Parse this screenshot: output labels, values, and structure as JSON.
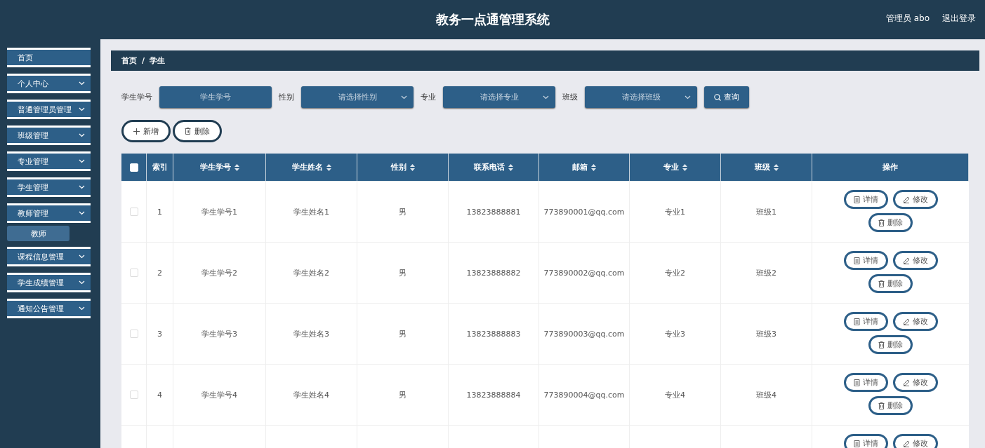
{
  "header": {
    "title": "教务一点通管理系统",
    "user": "管理员 abo",
    "logout": "退出登录"
  },
  "sidebar": {
    "items": [
      {
        "label": "首页",
        "expandable": false
      },
      {
        "label": "个人中心",
        "expandable": true
      },
      {
        "label": "普通管理员管理",
        "expandable": true
      },
      {
        "label": "班级管理",
        "expandable": true
      },
      {
        "label": "专业管理",
        "expandable": true
      },
      {
        "label": "学生管理",
        "expandable": true
      },
      {
        "label": "教师管理",
        "expandable": true,
        "expanded": true,
        "children": [
          {
            "label": "教师",
            "hovered": true
          }
        ]
      },
      {
        "label": "课程信息管理",
        "expandable": true
      },
      {
        "label": "学生成绩管理",
        "expandable": true
      },
      {
        "label": "通知公告管理",
        "expandable": true
      }
    ]
  },
  "breadcrumb": [
    "首页",
    "学生"
  ],
  "breadcrumb_separator": "/",
  "filters": [
    {
      "kind": "input",
      "label": "学生学号",
      "placeholder": "学生学号"
    },
    {
      "kind": "select",
      "label": "性别",
      "placeholder": "请选择性别"
    },
    {
      "kind": "select",
      "label": "专业",
      "placeholder": "请选择专业"
    },
    {
      "kind": "select",
      "label": "班级",
      "placeholder": "请选择班级"
    }
  ],
  "search_button": "查询",
  "actions": [
    {
      "kind": "add",
      "label": "新增"
    },
    {
      "kind": "delete",
      "label": "删除"
    }
  ],
  "table": {
    "all_checked": false,
    "columns": [
      {
        "label": "索引",
        "sortable": false
      },
      {
        "label": "学生学号",
        "sortable": true
      },
      {
        "label": "学生姓名",
        "sortable": true
      },
      {
        "label": "性别",
        "sortable": true
      },
      {
        "label": "联系电话",
        "sortable": true
      },
      {
        "label": "邮箱",
        "sortable": true
      },
      {
        "label": "专业",
        "sortable": true
      },
      {
        "label": "班级",
        "sortable": true
      },
      {
        "label": "操作",
        "sortable": false
      }
    ],
    "rows": [
      {
        "checked": false,
        "cells": [
          "1",
          "学生学号1",
          "学生姓名1",
          "男",
          "13823888881",
          "773890001@qq.com",
          "专业1",
          "班级1"
        ],
        "buttons": [
          {
            "kind": "detail",
            "label": "详情"
          },
          {
            "kind": "edit",
            "label": "修改"
          },
          {
            "kind": "delete",
            "label": "删除"
          }
        ]
      },
      {
        "checked": false,
        "cells": [
          "2",
          "学生学号2",
          "学生姓名2",
          "男",
          "13823888882",
          "773890002@qq.com",
          "专业2",
          "班级2"
        ],
        "buttons": [
          {
            "kind": "detail",
            "label": "详情"
          },
          {
            "kind": "edit",
            "label": "修改"
          },
          {
            "kind": "delete",
            "label": "删除"
          }
        ]
      },
      {
        "checked": false,
        "cells": [
          "3",
          "学生学号3",
          "学生姓名3",
          "男",
          "13823888883",
          "773890003@qq.com",
          "专业3",
          "班级3"
        ],
        "buttons": [
          {
            "kind": "detail",
            "label": "详情"
          },
          {
            "kind": "edit",
            "label": "修改"
          },
          {
            "kind": "delete",
            "label": "删除"
          }
        ]
      },
      {
        "checked": false,
        "cells": [
          "4",
          "学生学号4",
          "学生姓名4",
          "男",
          "13823888884",
          "773890004@qq.com",
          "专业4",
          "班级4"
        ],
        "buttons": [
          {
            "kind": "detail",
            "label": "详情"
          },
          {
            "kind": "edit",
            "label": "修改"
          },
          {
            "kind": "delete",
            "label": "删除"
          }
        ]
      },
      {
        "cells": [],
        "buttons": [
          {
            "kind": "detail",
            "label": "详情"
          },
          {
            "kind": "edit",
            "label": "修改"
          }
        ]
      }
    ]
  }
}
